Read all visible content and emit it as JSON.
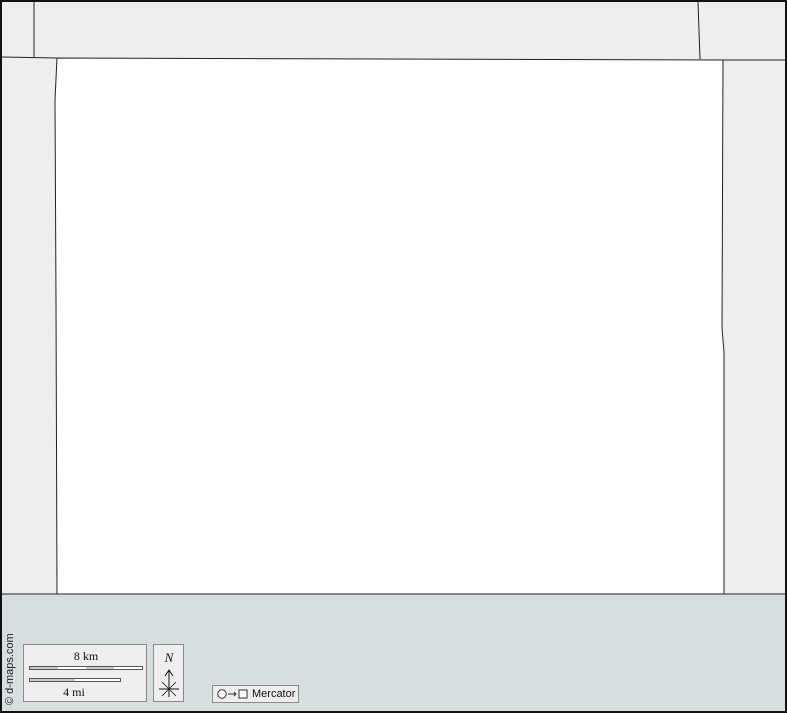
{
  "map": {
    "colors": {
      "land_outside": "#eeeeee",
      "area_fill": "#ffffff",
      "water": "#d6dfdf",
      "border": "#111111"
    },
    "credit": "© d-maps.com",
    "scale": {
      "km_label": "8 km",
      "mi_label": "4 mi"
    },
    "north_arrow": {
      "label": "N",
      "icon": "compass-rose-icon"
    },
    "projection": {
      "label": "Mercator",
      "icon": "circle-to-square-icon"
    }
  }
}
